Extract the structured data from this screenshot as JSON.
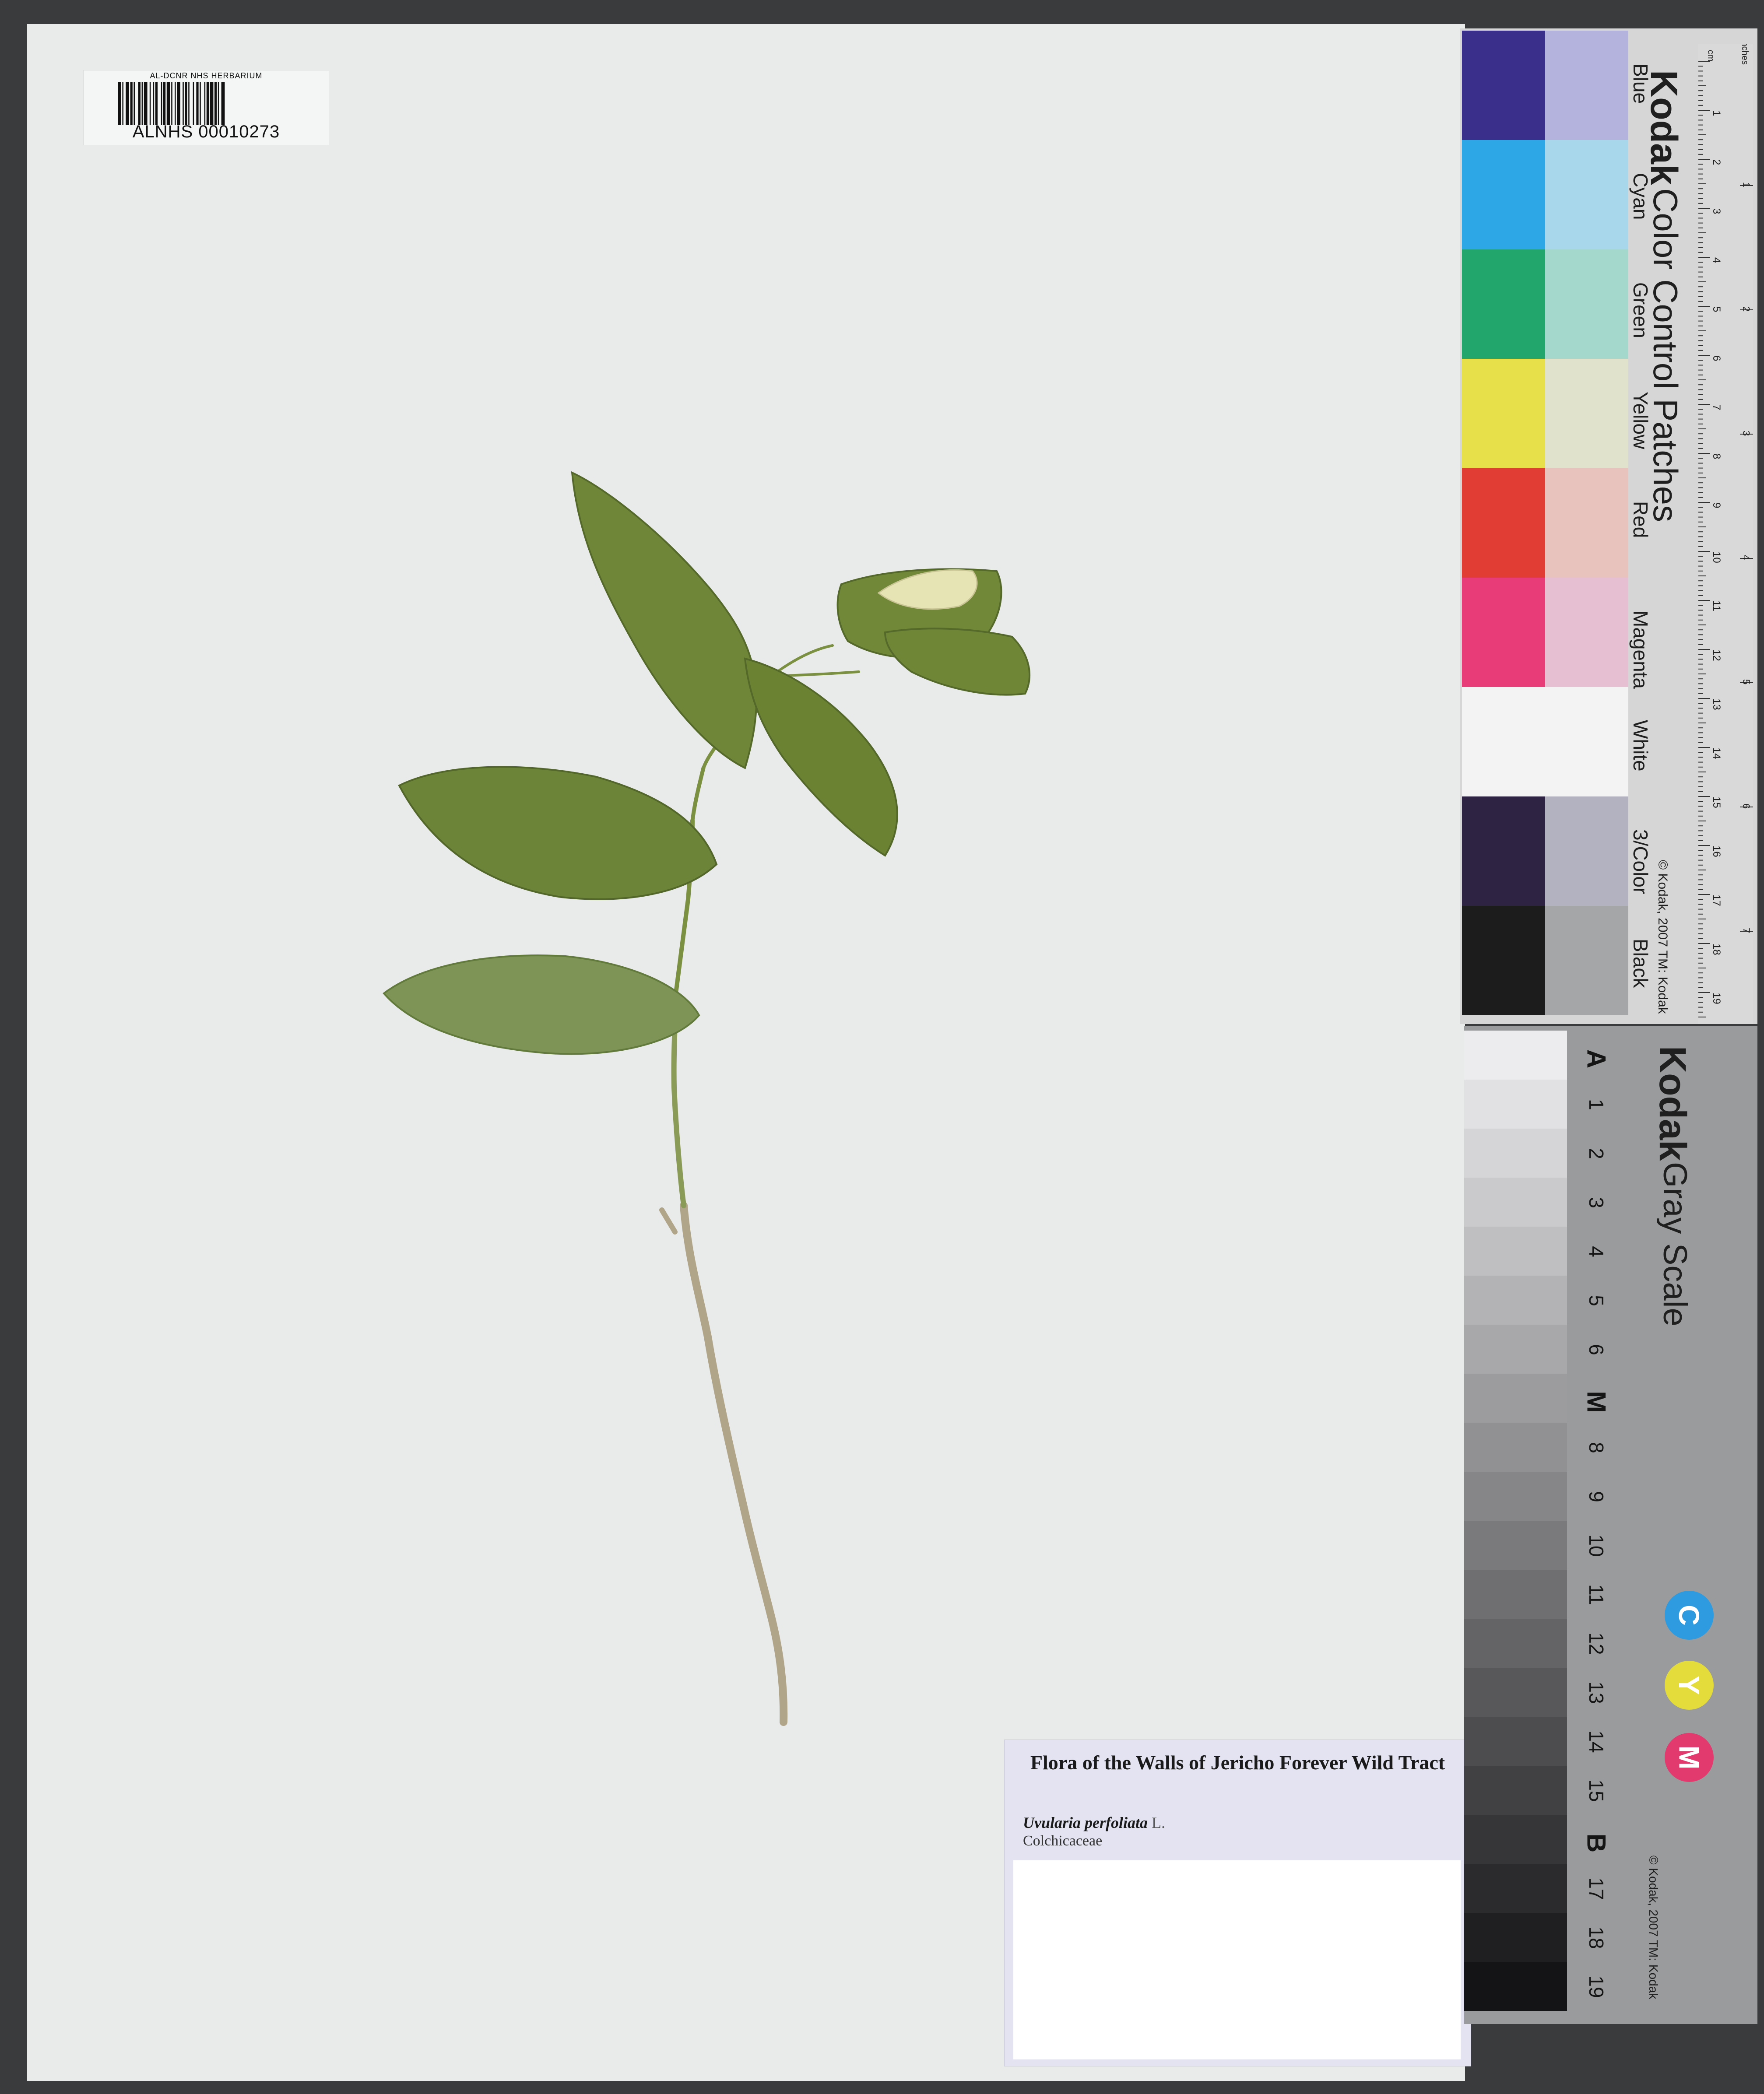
{
  "barcode_label": {
    "institution": "AL-DCNR NHS HERBARIUM",
    "catalog_number": "ALNHS 00010273"
  },
  "determination_label": {
    "title": "Flora of the Walls of Jericho Forever Wild Tract",
    "species": "Uvularia perfoliata",
    "author": "L.",
    "family": "Colchicaceae"
  },
  "color_card": {
    "brand": "Kodak",
    "title": "Color Control Patches",
    "copyright": "© Kodak, 2007 TM: Kodak",
    "unit_cm": "cm",
    "unit_inches": "inches",
    "cm_ticks": [
      "1",
      "2",
      "3",
      "4",
      "5",
      "6",
      "7",
      "8",
      "9",
      "10",
      "11",
      "12",
      "13",
      "14",
      "15",
      "16",
      "17",
      "18",
      "19"
    ],
    "inch_ticks": [
      "1",
      "2",
      "3",
      "4",
      "5",
      "6",
      "7",
      "8"
    ],
    "patches": [
      {
        "label": "Blue",
        "color": "#3b2f8c",
        "tint": "#b4b3dd"
      },
      {
        "label": "Cyan",
        "color": "#2ea7e6",
        "tint": "#a8d6ea"
      },
      {
        "label": "Green",
        "color": "#23a66b",
        "tint": "#a5d8cc"
      },
      {
        "label": "Yellow",
        "color": "#e8e04a",
        "tint": "#e0e2cb"
      },
      {
        "label": "Red",
        "color": "#e23d34",
        "tint": "#e8c3bd"
      },
      {
        "label": "Magenta",
        "color": "#e73c78",
        "tint": "#e6bfd3"
      },
      {
        "label": "White",
        "color": "#f3f3f3",
        "tint": "#f3f3f3"
      },
      {
        "label": "3/Color",
        "color": "#2e2343",
        "tint": "#b3b2c0"
      },
      {
        "label": "Black",
        "color": "#1c1c1d",
        "tint": "#a5a6a7"
      }
    ]
  },
  "gray_card": {
    "brand": "Kodak",
    "title": "Gray Scale",
    "copyright": "© Kodak, 2007 TM: Kodak",
    "steps": [
      "A",
      "1",
      "2",
      "3",
      "4",
      "5",
      "6",
      "M",
      "8",
      "9",
      "10",
      "11",
      "12",
      "13",
      "14",
      "15",
      "B",
      "17",
      "18",
      "19"
    ],
    "badges": [
      {
        "letter": "C",
        "color": "#2e9be0"
      },
      {
        "letter": "Y",
        "color": "#e3dc3a"
      },
      {
        "letter": "M",
        "color": "#e23a6f"
      }
    ]
  }
}
